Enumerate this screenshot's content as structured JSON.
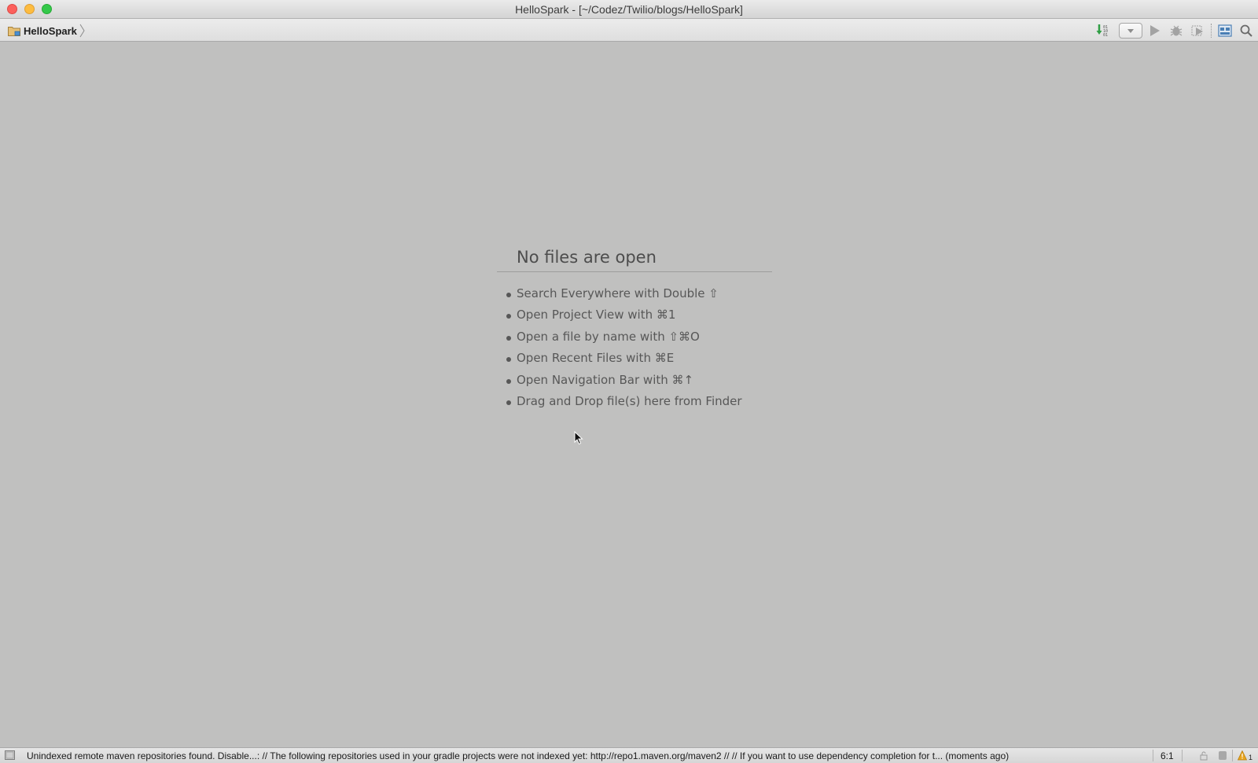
{
  "window": {
    "title": "HelloSpark - [~/Codez/Twilio/blogs/HelloSpark]"
  },
  "navbar": {
    "breadcrumb": [
      {
        "label": "HelloSpark",
        "icon": "folder-icon"
      }
    ],
    "toolbar_icons": [
      "vcs-update-icon",
      "run-configuration-dropdown",
      "run-icon",
      "debug-icon",
      "run-with-coverage-icon",
      "project-structure-icon",
      "search-icon"
    ]
  },
  "editor": {
    "empty_title": "No files are open",
    "hints": [
      "Search Everywhere with Double ⇧",
      "Open Project View with ⌘1",
      "Open a file by name with ⇧⌘O",
      "Open Recent Files with ⌘E",
      "Open Navigation Bar with ⌘↑",
      "Drag and Drop file(s) here from Finder"
    ]
  },
  "statusbar": {
    "message": "Unindexed remote maven repositories found. Disable...: // The following repositories used in your gradle projects were not indexed yet: http://repo1.maven.org/maven2 // // If you want to use dependency completion for t... (moments ago)",
    "caret_position": "6:1",
    "warning_count": "1",
    "colors": {
      "warning": "#e8a41c"
    }
  }
}
